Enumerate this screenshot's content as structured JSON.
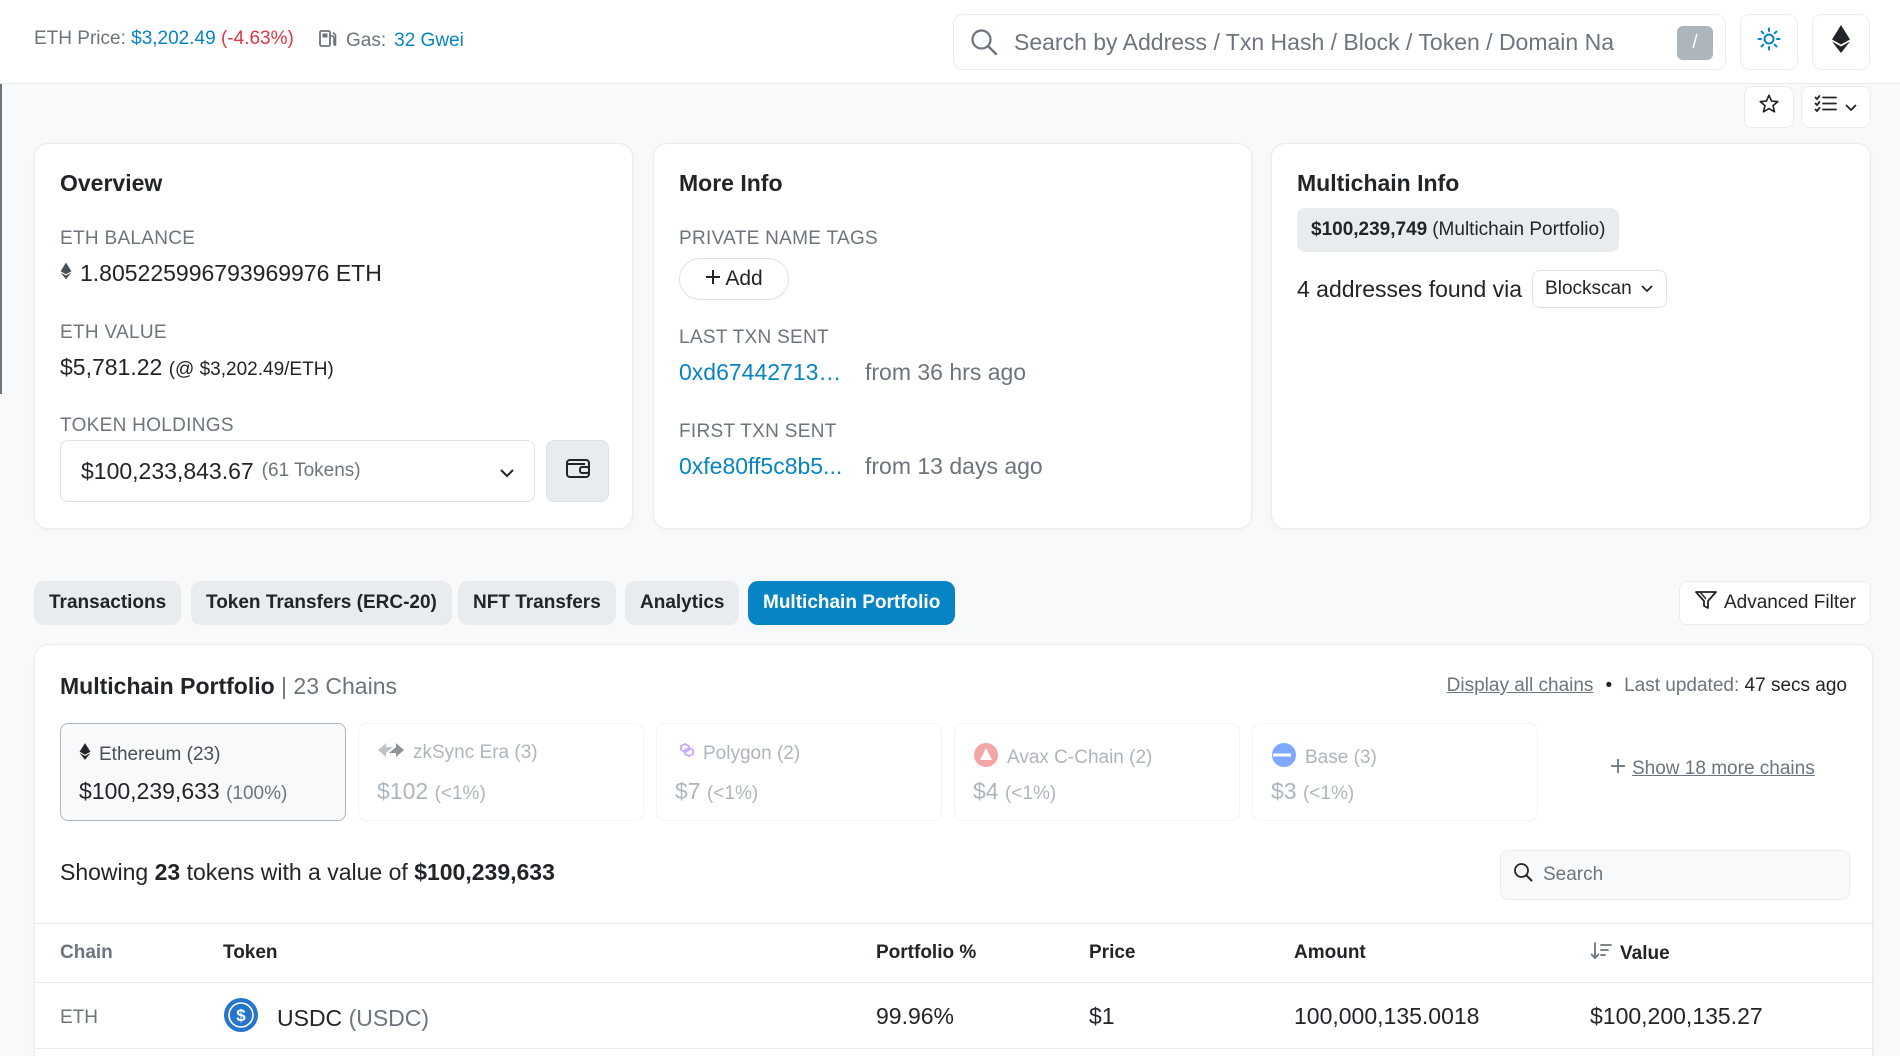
{
  "header": {
    "eth_price_label": "ETH Price:",
    "eth_price_value": "$3,202.49",
    "eth_price_change": "(-4.63%)",
    "gas_label": "Gas:",
    "gas_value": "32 Gwei",
    "search_placeholder": "Search by Address / Txn Hash / Block / Token / Domain Name",
    "search_shortcut": "/"
  },
  "overview": {
    "title": "Overview",
    "eth_balance_label": "ETH BALANCE",
    "eth_balance_value": "1.805225996793969976 ETH",
    "eth_value_label": "ETH VALUE",
    "eth_value_amount": "$5,781.22",
    "eth_value_rate": "(@ $3,202.49/ETH)",
    "token_holdings_label": "TOKEN HOLDINGS",
    "token_holdings_value": "$100,233,843.67",
    "token_holdings_count": "(61 Tokens)"
  },
  "more_info": {
    "title": "More Info",
    "private_tags_label": "PRIVATE NAME TAGS",
    "add_label": "Add",
    "last_txn_label": "LAST TXN SENT",
    "last_txn_hash": "0xd67442713a...",
    "last_txn_time": "from 36 hrs ago",
    "first_txn_label": "FIRST TXN SENT",
    "first_txn_hash": "0xfe80ff5c8b5...",
    "first_txn_time": "from 13 days ago"
  },
  "multichain_info": {
    "title": "Multichain Info",
    "portfolio_value": "$100,239,749",
    "portfolio_label": "(Multichain Portfolio)",
    "found_text": "4 addresses found via",
    "via_option": "Blockscan"
  },
  "tabs": [
    {
      "label": "Transactions"
    },
    {
      "label": "Token Transfers (ERC-20)"
    },
    {
      "label": "NFT Transfers"
    },
    {
      "label": "Analytics"
    },
    {
      "label": "Multichain Portfolio",
      "active": true
    }
  ],
  "advanced_filter_label": "Advanced Filter",
  "portfolio": {
    "title": "Multichain Portfolio",
    "chains_count": "| 23 Chains",
    "display_all_label": "Display all chains",
    "bullet": "•",
    "last_updated_label": "Last updated:",
    "last_updated_value": "47 secs ago",
    "chains": [
      {
        "name": "Ethereum (23)",
        "value": "$100,239,633",
        "pct": "(100%)",
        "icon": "ethereum-icon"
      },
      {
        "name": "zkSync Era (3)",
        "value": "$102",
        "pct": "(<1%)",
        "icon": "zksync-icon"
      },
      {
        "name": "Polygon (2)",
        "value": "$7",
        "pct": "(<1%)",
        "icon": "polygon-icon"
      },
      {
        "name": "Avax C-Chain (2)",
        "value": "$4",
        "pct": "(<1%)",
        "icon": "avalanche-icon"
      },
      {
        "name": "Base (3)",
        "value": "$3",
        "pct": "(<1%)",
        "icon": "base-icon"
      }
    ],
    "show_more_label": "Show 18 more chains",
    "showing_prefix": "Showing",
    "showing_count": "23",
    "showing_mid": "tokens with a value of",
    "showing_value": "$100,239,633",
    "search_placeholder": "Search",
    "columns": [
      "Chain",
      "Token",
      "Portfolio %",
      "Price",
      "Amount",
      "Value"
    ],
    "rows": [
      {
        "chain": "ETH",
        "token_name": "USDC",
        "token_symbol": "(USDC)",
        "portfolio_pct": "99.96%",
        "price": "$1",
        "amount": "100,000,135.0018",
        "value": "$100,200,135.27"
      }
    ]
  },
  "colors": {
    "accent": "#0784c3",
    "negative": "#dc3545",
    "usdc": "#2775ca",
    "avax": "#e84142",
    "base": "#0052ff",
    "polygon": "#8247e5"
  }
}
